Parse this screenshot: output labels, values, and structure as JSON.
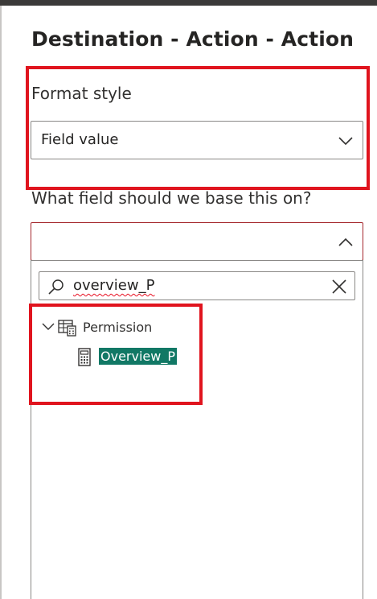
{
  "panel": {
    "title": "Destination - Action - Action"
  },
  "format_style": {
    "label": "Format style",
    "selected": "Field value"
  },
  "base_field": {
    "label": "What field should we base this on?",
    "selected": ""
  },
  "search": {
    "value": "overview_P"
  },
  "tree": {
    "table": {
      "name": "Permission",
      "expanded": true,
      "icon": "table-icon"
    },
    "fields": [
      {
        "name": "Overview_P",
        "icon": "calculator-icon",
        "selected": true
      }
    ]
  },
  "colors": {
    "highlight_bg": "#117865",
    "annotation_red": "#e0141e"
  }
}
